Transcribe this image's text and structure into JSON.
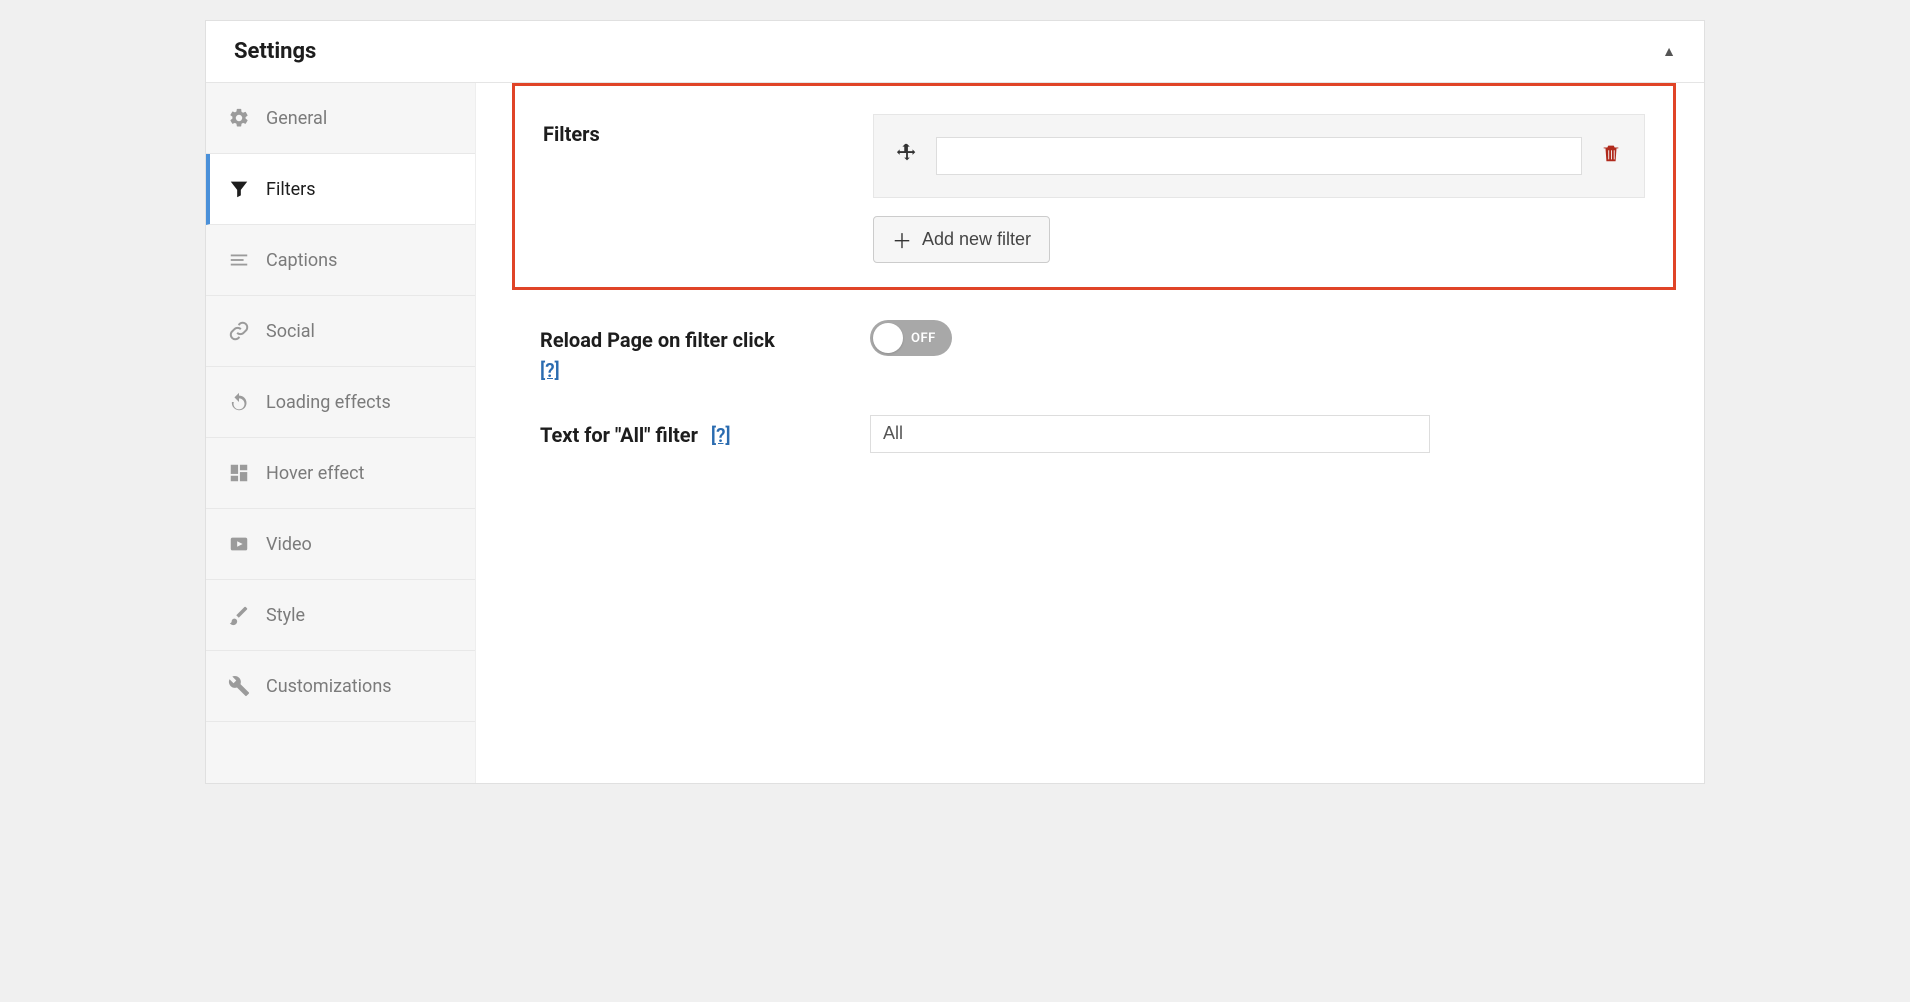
{
  "panel": {
    "title": "Settings",
    "collapse_glyph": "▲"
  },
  "sidebar": {
    "items": [
      {
        "label": "General"
      },
      {
        "label": "Filters"
      },
      {
        "label": "Captions"
      },
      {
        "label": "Social"
      },
      {
        "label": "Loading effects"
      },
      {
        "label": "Hover effect"
      },
      {
        "label": "Video"
      },
      {
        "label": "Style"
      },
      {
        "label": "Customizations"
      }
    ],
    "active_index": 1
  },
  "filters_section": {
    "label": "Filters",
    "filter_value": "",
    "add_button_label": "Add new filter"
  },
  "reload_section": {
    "label": "Reload Page on filter click",
    "help_text": "[?]",
    "toggle_state": "OFF"
  },
  "all_text_section": {
    "label": "Text for \"All\" filter",
    "help_text": "[?]",
    "value": "All"
  }
}
